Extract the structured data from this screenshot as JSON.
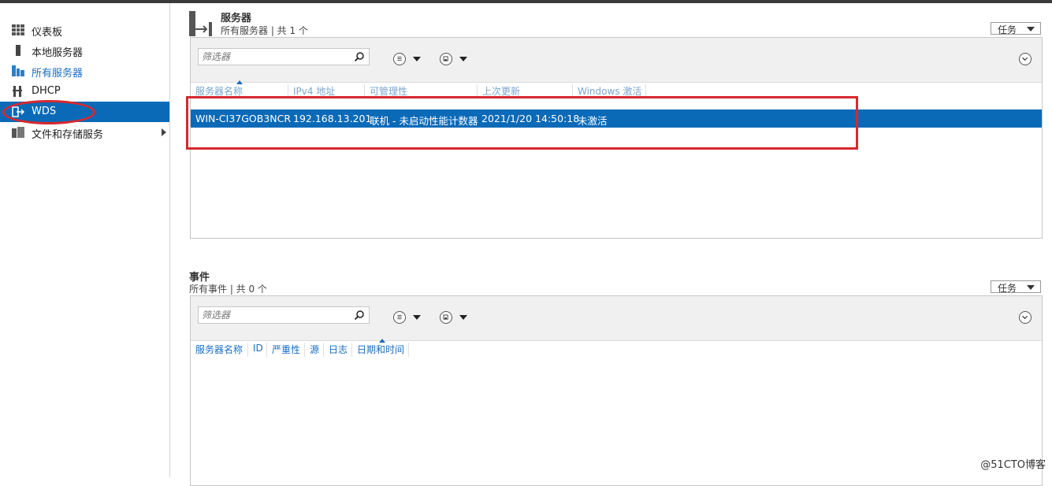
{
  "sidebar": {
    "items": [
      {
        "label": "仪表板",
        "icon": "dashboard-grid-icon"
      },
      {
        "label": "本地服务器",
        "icon": "local-server-icon"
      },
      {
        "label": "所有服务器",
        "icon": "all-servers-icon"
      },
      {
        "label": "DHCP",
        "icon": "dhcp-icon"
      },
      {
        "label": "WDS",
        "icon": "wds-icon"
      },
      {
        "label": "文件和存储服务",
        "icon": "file-storage-icon"
      }
    ]
  },
  "servers": {
    "title": "服务器",
    "subtitle": "所有服务器 | 共 1 个",
    "tasks_label": "任务",
    "filter_placeholder": "筛选器",
    "columns": [
      "服务器名称",
      "IPv4 地址",
      "可管理性",
      "上次更新",
      "Windows 激活"
    ],
    "rows": [
      [
        "WIN-CI37GOB3NCR",
        "192.168.13.201",
        "联机 - 未启动性能计数器",
        "2021/1/20 14:50:18",
        "未激活"
      ]
    ]
  },
  "events": {
    "title": "事件",
    "subtitle": "所有事件 | 共 0 个",
    "tasks_label": "任务",
    "filter_placeholder": "筛选器",
    "columns": [
      "服务器名称",
      "ID",
      "严重性",
      "源",
      "日志",
      "日期和时间"
    ]
  },
  "colors": {
    "accent": "#0b6ab7",
    "link": "#1a6ec0",
    "annotation": "#d8282f"
  },
  "watermark": "@51CTO博客"
}
